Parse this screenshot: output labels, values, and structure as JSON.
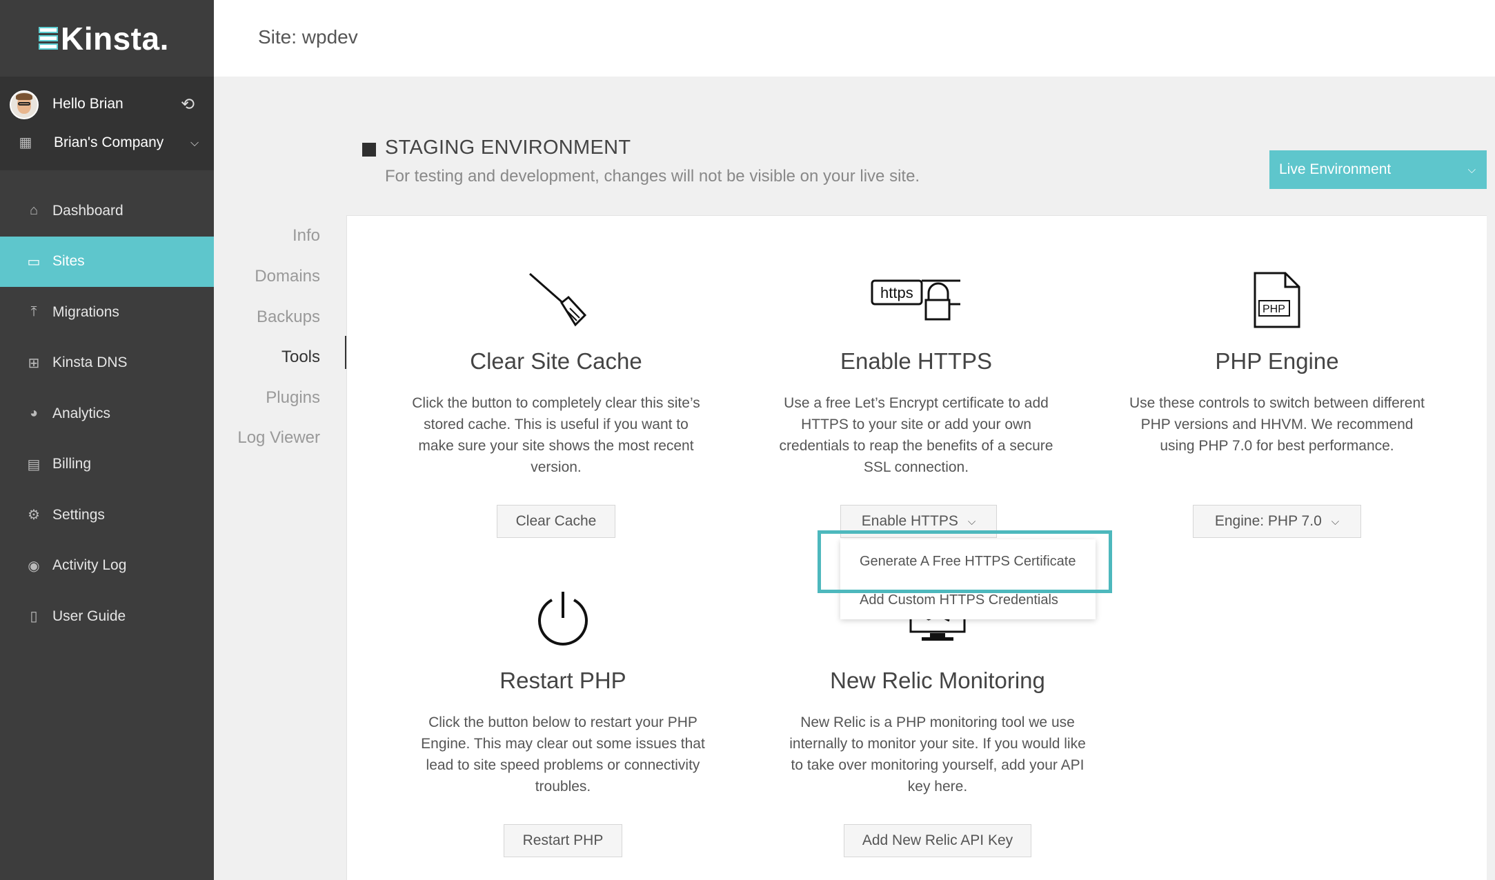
{
  "sidebar": {
    "logo_text": "Kinsta.",
    "user": {
      "greeting": "Hello Brian",
      "company": "Brian's Company"
    },
    "items": [
      {
        "label": "Dashboard",
        "icon": "home-icon"
      },
      {
        "label": "Sites",
        "icon": "monitor-icon",
        "active": true
      },
      {
        "label": "Migrations",
        "icon": "upload-icon"
      },
      {
        "label": "Kinsta DNS",
        "icon": "grid-icon"
      },
      {
        "label": "Analytics",
        "icon": "pie-chart-icon"
      },
      {
        "label": "Billing",
        "icon": "credit-card-icon"
      },
      {
        "label": "Settings",
        "icon": "gear-icon"
      },
      {
        "label": "Activity Log",
        "icon": "eye-icon"
      },
      {
        "label": "User Guide",
        "icon": "book-icon"
      }
    ]
  },
  "header": {
    "title": "Site: wpdev"
  },
  "environment": {
    "title": "STAGING ENVIRONMENT",
    "subtitle": "For testing and development, changes will not be visible on your live site.",
    "selector_label": "Live Environment"
  },
  "subnav": [
    {
      "label": "Info"
    },
    {
      "label": "Domains"
    },
    {
      "label": "Backups"
    },
    {
      "label": "Tools",
      "active": true
    },
    {
      "label": "Plugins"
    },
    {
      "label": "Log Viewer"
    }
  ],
  "tools": {
    "clear_cache": {
      "title": "Clear Site Cache",
      "description": "Click the button to completely clear this site’s stored cache. This is useful if you want to make sure your site shows the most recent version.",
      "button": "Clear Cache",
      "icon": "broom-icon"
    },
    "https": {
      "title": "Enable HTTPS",
      "description": "Use a free Let’s Encrypt certificate to add HTTPS to your site or add your own credentials to reap the benefits of a secure SSL connection.",
      "button": "Enable HTTPS",
      "icon_text": "https",
      "menu": [
        "Generate A Free HTTPS Certificate",
        "Add Custom HTTPS Credentials"
      ]
    },
    "php_engine": {
      "title": "PHP Engine",
      "description": "Use these controls to switch between different PHP versions and HHVM. We recommend using PHP 7.0 for best performance.",
      "button": "Engine: PHP 7.0",
      "icon_text": "PHP"
    },
    "restart_php": {
      "title": "Restart PHP",
      "description": "Click the button below to restart your PHP Engine. This may clear out some issues that lead to site speed problems or connectivity troubles.",
      "button": "Restart PHP",
      "icon": "power-icon"
    },
    "new_relic": {
      "title": "New Relic Monitoring",
      "description": "New Relic is a PHP monitoring tool we use internally to monitor your site. If you would like to take over monitoring yourself, add your API key here.",
      "button": "Add New Relic API Key",
      "icon": "monitor-chart-icon"
    }
  }
}
